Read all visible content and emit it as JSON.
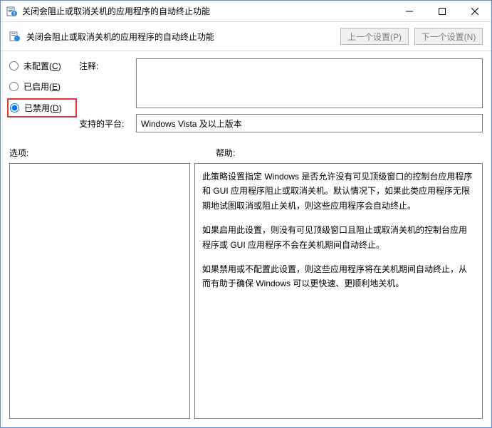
{
  "titlebar": {
    "title": "关闭会阻止或取消关机的应用程序的自动终止功能"
  },
  "toolbar": {
    "policy_title": "关闭会阻止或取消关机的应用程序的自动终止功能",
    "prev_label": "上一个设置(P)",
    "next_label": "下一个设置(N)"
  },
  "radios": {
    "not_configured": {
      "label": "未配置",
      "key": "C"
    },
    "enabled": {
      "label": "已启用",
      "key": "E"
    },
    "disabled": {
      "label": "已禁用",
      "key": "D"
    },
    "selected": "disabled"
  },
  "labels": {
    "comment": "注释:",
    "platform": "支持的平台:",
    "options": "选项:",
    "help": "帮助:"
  },
  "platform_value": "Windows Vista 及以上版本",
  "help_paragraphs": [
    "此策略设置指定 Windows 是否允许没有可见顶级窗口的控制台应用程序和 GUI 应用程序阻止或取消关机。默认情况下，如果此类应用程序无限期地试图取消或阻止关机，则这些应用程序会自动终止。",
    "如果启用此设置，则没有可见顶级窗口且阻止或取消关机的控制台应用程序或 GUI 应用程序不会在关机期间自动终止。",
    "如果禁用或不配置此设置，则这些应用程序将在关机期间自动终止，从而有助于确保 Windows 可以更快速、更顺利地关机。"
  ]
}
